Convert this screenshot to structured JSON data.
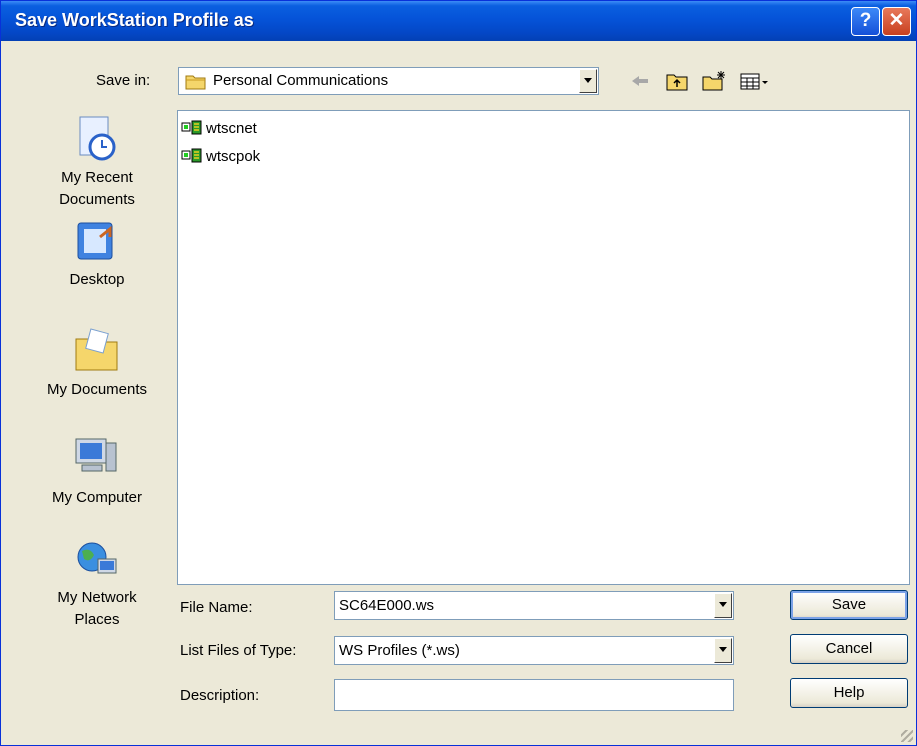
{
  "window": {
    "title": "Save WorkStation Profile as",
    "help_glyph": "?",
    "close_glyph": "✕"
  },
  "save_in": {
    "label": "Save in:",
    "value": "Personal Communications"
  },
  "toolbar": {
    "icons": [
      "back-arrow-icon",
      "up-folder-icon",
      "new-folder-icon",
      "view-menu-icon"
    ]
  },
  "places": [
    {
      "label_line1": "My Recent",
      "label_line2": "Documents",
      "icon": "recent-documents-icon"
    },
    {
      "label_line1": "Desktop",
      "label_line2": "",
      "icon": "desktop-icon"
    },
    {
      "label_line1": "My Documents",
      "label_line2": "",
      "icon": "my-documents-icon"
    },
    {
      "label_line1": "My Computer",
      "label_line2": "",
      "icon": "my-computer-icon"
    },
    {
      "label_line1": "My Network",
      "label_line2": "Places",
      "icon": "network-places-icon"
    }
  ],
  "files": [
    {
      "name": "wtscnet",
      "icon": "workstation-profile-icon"
    },
    {
      "name": "wtscpok",
      "icon": "workstation-profile-icon"
    }
  ],
  "fields": {
    "file_name_label": "File Name:",
    "file_name_value": "SC64E000.ws",
    "type_label": "List Files of Type:",
    "type_value": "WS Profiles (*.ws)",
    "description_label": "Description:",
    "description_value": ""
  },
  "buttons": {
    "save": "Save",
    "cancel": "Cancel",
    "help": "Help"
  }
}
